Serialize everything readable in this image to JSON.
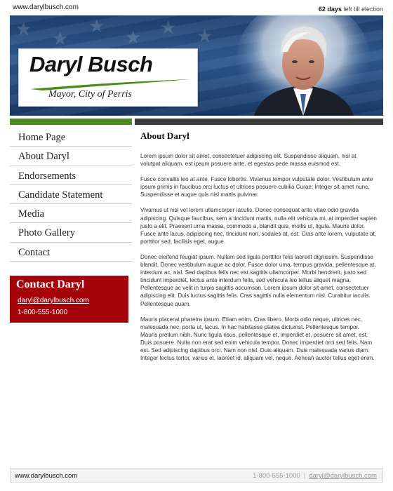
{
  "header": {
    "site_url": "www.darylbusch.com",
    "countdown_days": "62 days",
    "countdown_text": "left till election"
  },
  "banner": {
    "candidate_name": "Daryl Busch",
    "candidate_title": "Mayor, City of Perris",
    "accent_green": "#4c8c1d"
  },
  "nav": {
    "items": [
      {
        "label": "Home Page"
      },
      {
        "label": "About Daryl"
      },
      {
        "label": "Endorsements"
      },
      {
        "label": "Candidate Statement"
      },
      {
        "label": "Media"
      },
      {
        "label": "Photo Gallery"
      },
      {
        "label": "Contact"
      }
    ]
  },
  "contact_box": {
    "heading": "Contact Daryl",
    "email": "daryl@darylbusch.com",
    "phone": "1-800-555-1000",
    "background": "#a4050b"
  },
  "main": {
    "heading": "About Daryl",
    "paragraphs": [
      "Lorem ipsum dolor sit amet, consectetuer adipiscing elit. Suspendisse aliquam, nisl at volutpat aliquam, est ipsum posuere ante, et egestas pede massa euismod est.",
      "Fusce convallis leo at ante. Fusce lobortis. Vivamus tempor vulputate dolor. Vestibulum ante ipsum primis in faucibus orci luctus et ultrices posuere cubilia Curae; Integer sit amet nunc. Suspendisse et augue quis nisl mattis pulvinar.",
      "Vivamus ut nisl vel lorem ullamcorper iaculis. Donec consequat ante vitae odio gravida adipiscing. Quisque faucibus, sem a tincidunt mattis, nulla elit vehicula mi, at imperdiet sapien justo a elit. Praesent urna massa, commodo a, blandit quis, mollis ut, ligula. Mauris dolor. Fusce ante lacus, adipiscing nec, tincidunt non, sodales at, est. Cras ante lorem, vulputate at, porttitor sed, facilisis eget, augue.",
      "Donec eleifend feugiat ipsum. Nullam sed ligula porttitor felis laoreet dignissim. Suspendisse blandit. Donec vestibulum augue ac dolor. Fusce dolor uma, tempus gravida, pellentesque at, interdum ac, nisl. Sed dapibus felis nec est sagittis ullamcorper. Morbi hendrerit, justo sed tincidunt imperdiet, lectus ante interdum felis, sed vehicula leo tellus aliquet magna. Pellentesque ac velit in turpis sagittis accumsan. Lorem ipsum dolor sit amet, consectetuer adipiscing elit. Duis luctus sagittis felis. Cras sagittis nulla elementum nisl. Curabitur iaculis. Pellentesque quam.",
      "Mauris placerat pharetra ipsum. Etiam enim. Cras libero. Morbi odio neque, ultrices nec, malesuada nec, porta ut, lacus. In hac habitasse platea dictumst. Pellentesque tempor. Mauris pretium nibh. Nunc ligula risus, pellentesque et, imperdiet et, posuere sit amet, est. Duis posuere. Nulla non erat sed enim vehicula tempor. Donec imperdiet orci sed felis. Nam est. Sed adipiscing dapibus orci. Nam non nisl. Duis aliquam. Duis malesuada varius diam. Integer lectus tortor, varius et, laoreet id, aliquam vel, neque. Aenean auctor tellus eget enim."
    ]
  },
  "footer": {
    "site_url": "www.darylbusch.com",
    "phone": "1-800-555-1000",
    "separator": "|",
    "email": "daryl@darylbusch.com"
  }
}
